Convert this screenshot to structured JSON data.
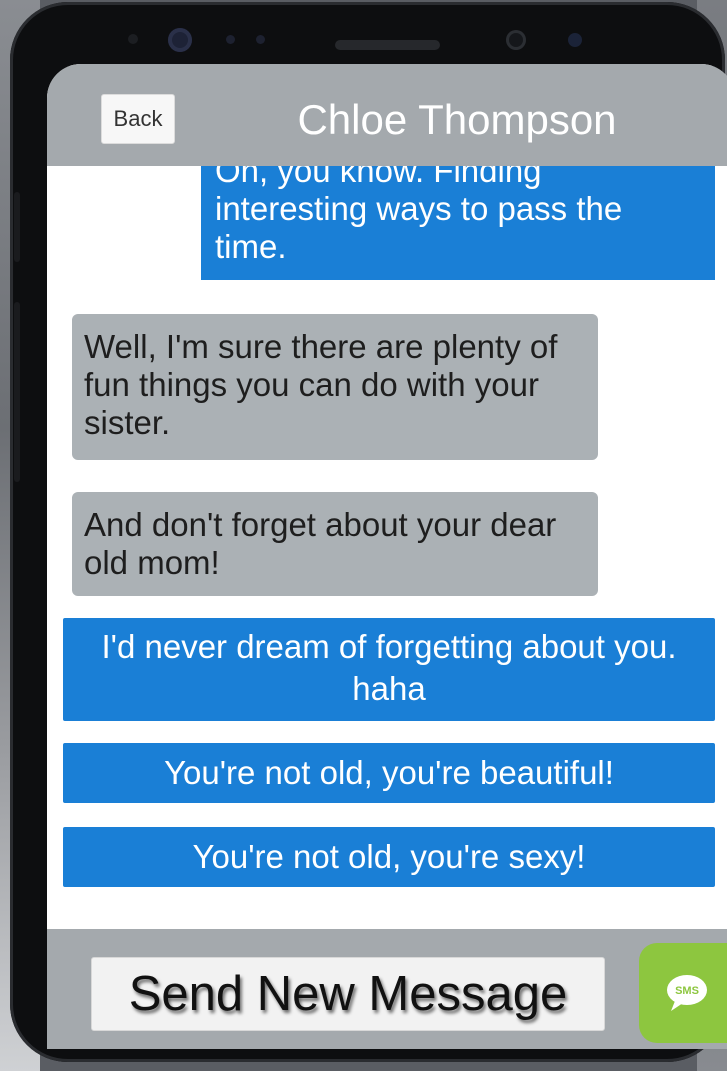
{
  "header": {
    "back_label": "Back",
    "contact_name": "Chloe Thompson"
  },
  "messages": [
    {
      "from": "me",
      "text": "Oh, you know. Finding interesting ways to pass the time."
    },
    {
      "from": "contact",
      "text": "Well, I'm sure there are plenty of fun things you can do with your sister."
    },
    {
      "from": "contact",
      "text": "And don't forget about your dear old mom!"
    }
  ],
  "reply_options": [
    "I'd never dream of forgetting about you. haha",
    "You're not old, you're beautiful!",
    "You're not old, you're sexy!"
  ],
  "footer": {
    "send_label": "Send New Message",
    "sms_icon_label": "SMS"
  },
  "colors": {
    "sent_bubble": "#1a7fd6",
    "received_bubble": "#abb1b5",
    "header_bar": "#a4a9ad",
    "sms_button": "#8dc63f"
  }
}
